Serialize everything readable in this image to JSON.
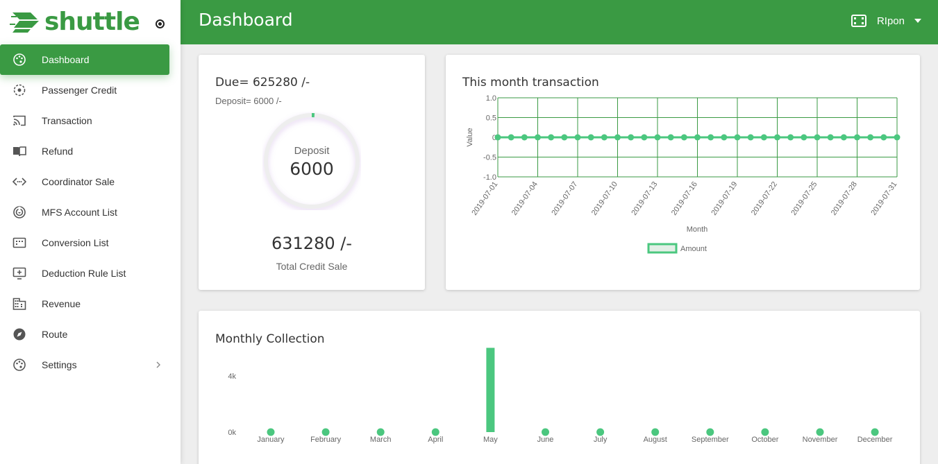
{
  "app": {
    "name": "shuttle"
  },
  "sidebar": {
    "items": [
      {
        "label": "Dashboard",
        "icon": "palette-icon",
        "active": true
      },
      {
        "label": "Passenger Credit",
        "icon": "target-icon"
      },
      {
        "label": "Transaction",
        "icon": "cast-icon"
      },
      {
        "label": "Refund",
        "icon": "book-icon"
      },
      {
        "label": "Coordinator Sale",
        "icon": "code-icon"
      },
      {
        "label": "MFS Account List",
        "icon": "radar-icon"
      },
      {
        "label": "Conversion List",
        "icon": "dialpad-icon"
      },
      {
        "label": "Deduction Rule List",
        "icon": "add-screen-icon"
      },
      {
        "label": "Revenue",
        "icon": "building-icon"
      },
      {
        "label": "Route",
        "icon": "compass-icon"
      },
      {
        "label": "Settings",
        "icon": "palette-icon",
        "has_submenu": true
      }
    ]
  },
  "header": {
    "title": "Dashboard",
    "user": {
      "name": "RIpon",
      "icon": "crop-free-icon"
    }
  },
  "due_card": {
    "due": "Due= 625280 /-",
    "deposit_sub": "Deposit= 6000 /-",
    "ring_label": "Deposit",
    "ring_value": "6000",
    "ring_fraction": 0.0095,
    "total_value": "631280 /-",
    "total_label": "Total Credit Sale"
  },
  "colors": {
    "brand": "#3a9a43",
    "chart_green": "#4bc77f",
    "ring_track": "#eeeeee"
  },
  "chart_data": [
    {
      "type": "line",
      "title": "This month transaction",
      "xlabel": "Month",
      "ylabel": "Value",
      "ylim": [
        -1.0,
        1.0
      ],
      "y_ticks": [
        "1.0",
        "0.5",
        "0",
        "-0.5",
        "-1.0"
      ],
      "x_tick_labels": [
        "2019-07-01",
        "2019-07-04",
        "2019-07-07",
        "2019-07-10",
        "2019-07-13",
        "2019-07-16",
        "2019-07-19",
        "2019-07-22",
        "2019-07-25",
        "2019-07-28",
        "2019-07-31"
      ],
      "x": [
        "2019-07-01",
        "2019-07-02",
        "2019-07-03",
        "2019-07-04",
        "2019-07-05",
        "2019-07-06",
        "2019-07-07",
        "2019-07-08",
        "2019-07-09",
        "2019-07-10",
        "2019-07-11",
        "2019-07-12",
        "2019-07-13",
        "2019-07-14",
        "2019-07-15",
        "2019-07-16",
        "2019-07-17",
        "2019-07-18",
        "2019-07-19",
        "2019-07-20",
        "2019-07-21",
        "2019-07-22",
        "2019-07-23",
        "2019-07-24",
        "2019-07-25",
        "2019-07-26",
        "2019-07-27",
        "2019-07-28",
        "2019-07-29",
        "2019-07-30",
        "2019-07-31"
      ],
      "series": [
        {
          "name": "Amount",
          "values": [
            0,
            0,
            0,
            0,
            0,
            0,
            0,
            0,
            0,
            0,
            0,
            0,
            0,
            0,
            0,
            0,
            0,
            0,
            0,
            0,
            0,
            0,
            0,
            0,
            0,
            0,
            0,
            0,
            0,
            0,
            0
          ]
        }
      ],
      "legend": "bottom-center",
      "grid": true
    },
    {
      "type": "bar",
      "title": "Monthly Collection",
      "categories": [
        "January",
        "February",
        "March",
        "April",
        "May",
        "June",
        "July",
        "August",
        "September",
        "October",
        "November",
        "December"
      ],
      "values": [
        0,
        0,
        0,
        0,
        6000,
        0,
        0,
        0,
        0,
        0,
        0,
        0
      ],
      "y_ticks": [
        "0k",
        "4k"
      ],
      "ylim": [
        0,
        6000
      ],
      "grid": false
    }
  ]
}
